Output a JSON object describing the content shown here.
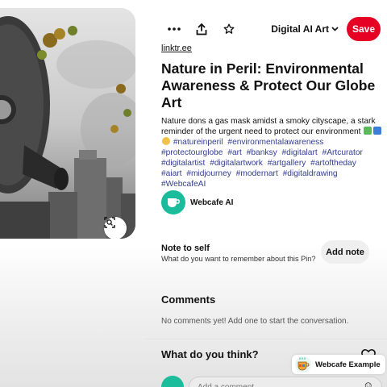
{
  "image": {
    "alt": "Nature in Peril: Environmental Awareness & Protect Our Globe Art",
    "visual_search_icon": "visual-search-icon"
  },
  "toolbar": {
    "more_icon": "more-options-icon",
    "share_icon": "share-icon",
    "favorite_icon": "star-icon",
    "board_label": "Digital AI Art",
    "save_label": "Save",
    "save_color": "#e60023"
  },
  "pin": {
    "link": "linktr.ee",
    "title": "Nature in Peril: Environmental Awareness & Protect Our Globe Art",
    "description": "Nature dons a gas mask amidst a smoky cityscape, a stark reminder of the urgent need to protect our environment",
    "hashtags": [
      "#natureinperil",
      "#environmentalawareness",
      "#protectourglobe",
      "#art",
      "#banksy",
      "#digitalart",
      "#Artcurator",
      "#digitalartist",
      "#digitalartwork",
      "#artgallery",
      "#artoftheday",
      "#aiart",
      "#midjourney",
      "#modernart",
      "#digitaldrawing",
      "#WebcafeAI"
    ],
    "hashtag_color": "#333d91"
  },
  "creator": {
    "name": "Webcafe AI",
    "avatar_color": "#1abc9c"
  },
  "note": {
    "title": "Note to self",
    "subtitle": "What do you want to remember about this Pin?",
    "button_label": "Add note"
  },
  "comments": {
    "heading": "Comments",
    "empty_text": "No comments yet! Add one to start the conversation.",
    "prompt": "What do you think?",
    "input_placeholder": "Add a comment",
    "emoji_icon": "smile-icon"
  },
  "badge": {
    "label": "Webcafe Example"
  }
}
